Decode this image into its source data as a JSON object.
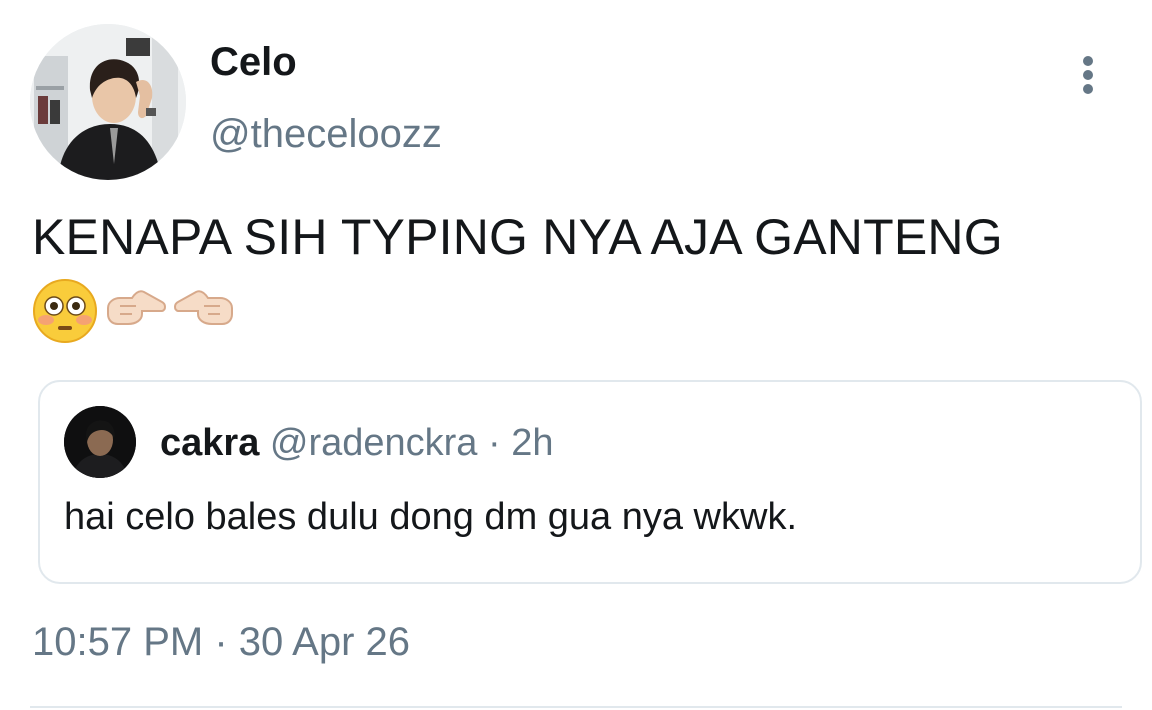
{
  "tweet": {
    "author": {
      "name": "Celo",
      "handle": "@theceloozz",
      "avatar_icon": "profile-photo"
    },
    "menu_icon": "more-vertical-icon",
    "text": "KENAPA SIH TYPING NYA AJA GANTENG",
    "emojis": [
      "flushed-face-emoji",
      "pointing-right-emoji",
      "pointing-left-emoji"
    ],
    "quote": {
      "author": {
        "name": "cakra",
        "handle": "@radenckra",
        "avatar_icon": "profile-photo"
      },
      "separator": "·",
      "time": "2h",
      "text": "hai celo bales dulu dong dm gua nya wkwk."
    },
    "timestamp": "10:57 PM · 30 Apr 26"
  },
  "colors": {
    "text_primary": "#14171a",
    "text_secondary": "#657786",
    "border": "#e1e8ed"
  }
}
